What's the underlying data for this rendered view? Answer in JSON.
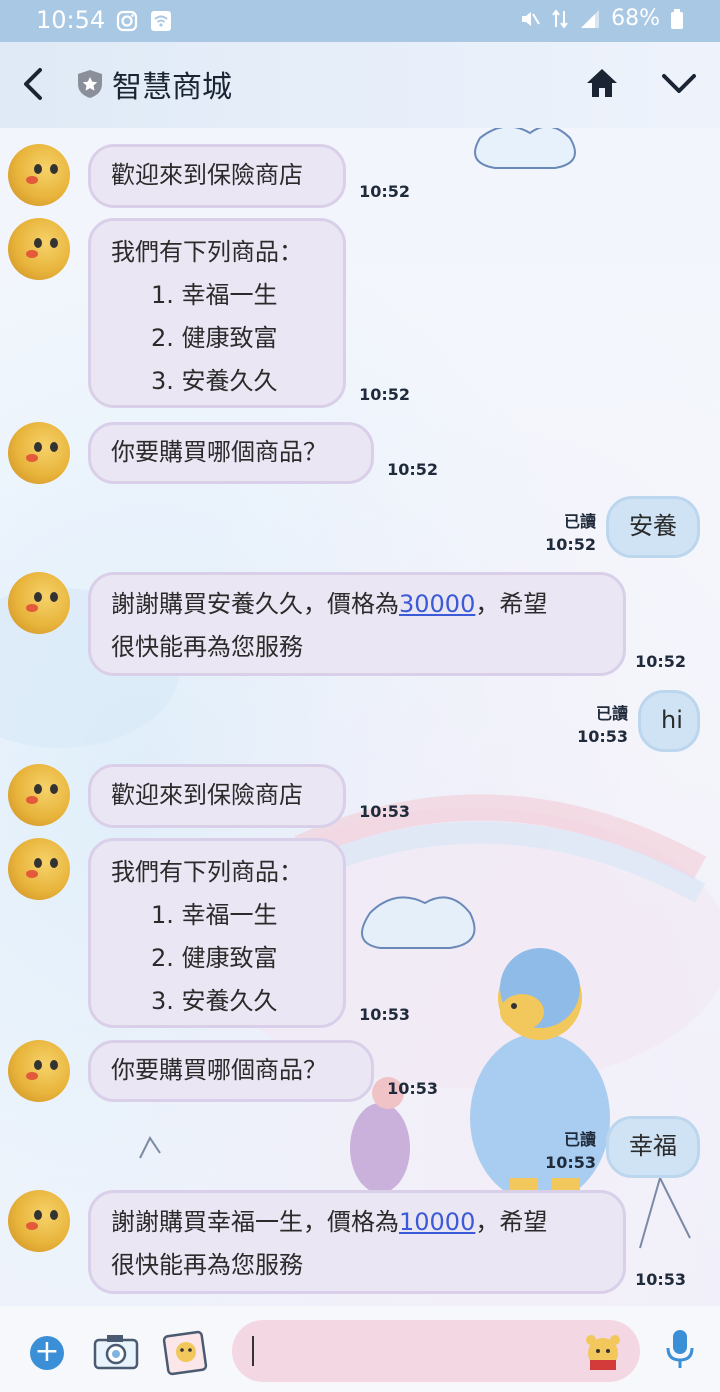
{
  "status_bar": {
    "time": "10:54",
    "battery": "68%"
  },
  "header": {
    "title": "智慧商城"
  },
  "messages": [
    {
      "dir": "in",
      "lines": [
        "歡迎來到保險商店"
      ],
      "time": "10:52"
    },
    {
      "dir": "in",
      "lines": [
        "我們有下列商品：",
        "1. 幸福一生",
        "2. 健康致富",
        "3. 安養久久"
      ],
      "time": "10:52"
    },
    {
      "dir": "in",
      "lines": [
        "你要購買哪個商品？"
      ],
      "time": "10:52"
    },
    {
      "dir": "out",
      "text": "安養",
      "read": "已讀",
      "time": "10:52"
    },
    {
      "dir": "in",
      "pre": "謝謝購買安養久久，價格為",
      "link": "30000",
      "post": "，希望",
      "line2": "很快能再為您服務",
      "time": "10:52"
    },
    {
      "dir": "out",
      "text": "hi",
      "read": "已讀",
      "time": "10:53"
    },
    {
      "dir": "in",
      "lines": [
        "歡迎來到保險商店"
      ],
      "time": "10:53"
    },
    {
      "dir": "in",
      "lines": [
        "我們有下列商品：",
        "1. 幸福一生",
        "2. 健康致富",
        "3. 安養久久"
      ],
      "time": "10:53"
    },
    {
      "dir": "in",
      "lines": [
        "你要購買哪個商品？"
      ],
      "time": "10:53"
    },
    {
      "dir": "out",
      "text": "幸福",
      "read": "已讀",
      "time": "10:53"
    },
    {
      "dir": "in",
      "pre": "謝謝購買幸福一生，價格為",
      "link": "10000",
      "post": "，希望",
      "line2": "很快能再為您服務",
      "time": "10:53"
    }
  ],
  "colors": {
    "status_bar": "#a9c8e4",
    "incoming_bubble": "#ebe6f3",
    "outgoing_bubble": "#cfe3f4",
    "link": "#3a5ad8",
    "input_bg": "#f3d7e2",
    "plus_button": "#3b8fd6"
  },
  "icons": {
    "back": "chevron-left-icon",
    "official": "shield-star-icon",
    "home": "home-icon",
    "menu": "chevron-down-icon",
    "add": "plus-icon",
    "camera": "camera-icon",
    "sticker": "sticker-icon",
    "mic": "microphone-icon"
  }
}
